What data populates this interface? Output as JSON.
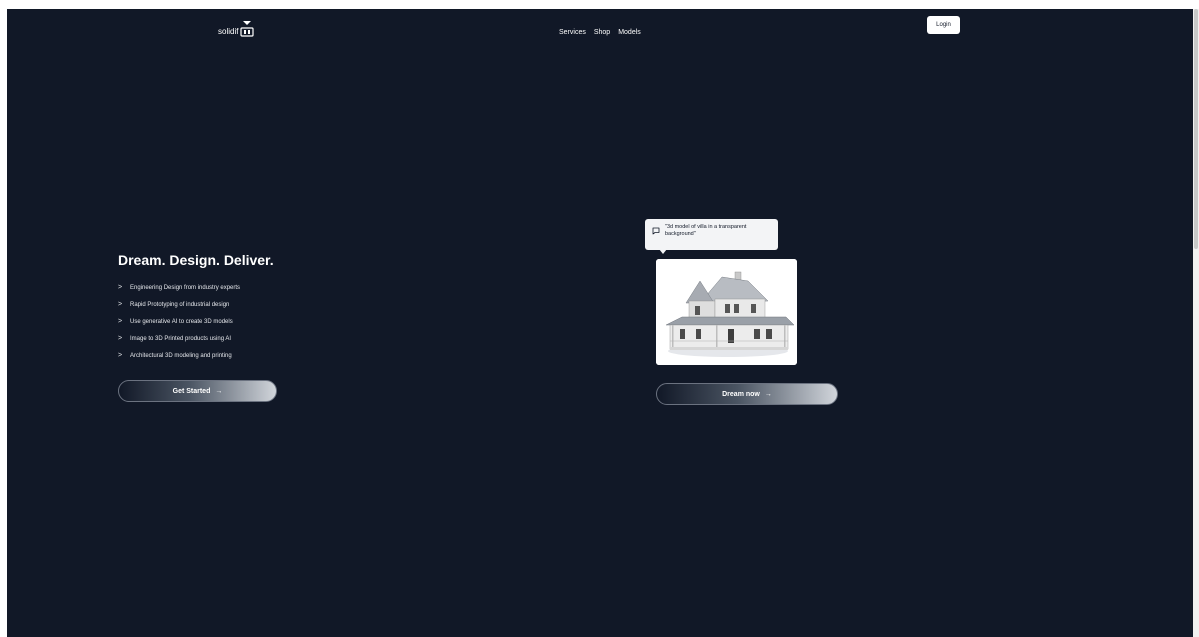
{
  "header": {
    "logo_text": "solidif",
    "nav": [
      "Services",
      "Shop",
      "Models"
    ],
    "login_label": "Login"
  },
  "hero": {
    "headline": "Dream. Design. Deliver.",
    "features": [
      "Engineering Design from industry experts",
      "Rapid Prototyping of industrial design",
      "Use generative AI to create 3D models",
      "Image to 3D Printed products using AI",
      "Architectural 3D modeling and printing"
    ],
    "cta_label": "Get Started",
    "cta_arrow": "→"
  },
  "demo": {
    "prompt_text": "\"3d model of villa in a transparent background\"",
    "prompt_icon": "chat-bubble-icon",
    "image_subject": "house-3d-model",
    "cta_label": "Dream now",
    "cta_arrow": "→"
  },
  "colors": {
    "background": "#111827",
    "text": "#ffffff",
    "button_gradient_end": "#d1d5db"
  }
}
